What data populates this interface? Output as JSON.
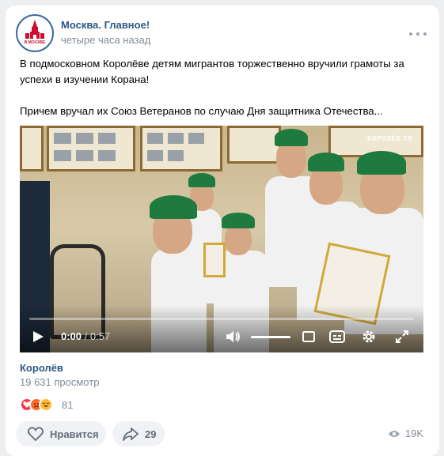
{
  "post": {
    "group_name": "Москва. Главное!",
    "time": "четыре часа назад",
    "avatar_text": "В МОСКВЕ",
    "text_line1": "В подмосковном Королёве детям мигрантов торжественно вручили грамоты за успехи в изучении Корана!",
    "text_line2": "Причем вручал их Союз Ветеранов по случаю Дня защитника Отечества..."
  },
  "video": {
    "watermark": "КОРОЛЁВ ТВ",
    "time_current": "0:00",
    "time_separator": " / ",
    "time_total": "0:57",
    "progress": 0,
    "volume": 1
  },
  "meta": {
    "location": "Королёв",
    "views_label": "19 631 просмотр"
  },
  "reactions": {
    "count": "81",
    "icons": [
      "heart-reaction",
      "angry-reaction",
      "laugh-reaction"
    ],
    "colors": {
      "heart": "#ff3347",
      "angry": "#ff6a2b",
      "laugh": "#ffb938"
    }
  },
  "actions": {
    "like_label": "Нравится",
    "share_count": "29",
    "views_short": "19K"
  },
  "colors": {
    "link": "#2a5885",
    "secondary": "#818c99",
    "button_bg": "#f0f2f5"
  }
}
